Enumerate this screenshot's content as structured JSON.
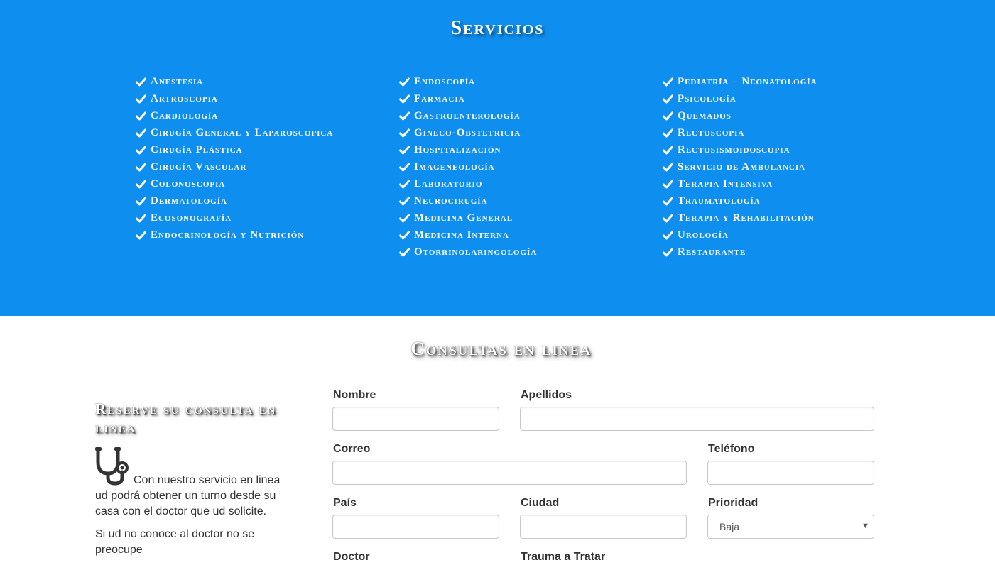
{
  "colors": {
    "services_bg": "#0e8ff0",
    "text": "#333333",
    "white": "#ffffff"
  },
  "services": {
    "title": "Servicios",
    "icon": "check-icon",
    "columns": [
      [
        "Anestesia",
        "Artroscopia",
        "Cardiología",
        "Cirugía General y Laparoscopica",
        "Cirugía Plástica",
        "Cirugía Vascular",
        "Colonoscopia",
        "Dermatología",
        "Ecosonografía",
        "Endocrinología y Nutrición"
      ],
      [
        "Endoscopía",
        "Farmacia",
        "Gastroenterología",
        "Gineco-Obstetricia",
        "Hospitalización",
        "Imageneología",
        "Laboratorio",
        "Neurocirugía",
        "Medicina General",
        "Medicina Interna",
        "Otorrinolaringología"
      ],
      [
        "Pediatría – Neonatología",
        "Psicología",
        "Quemados",
        "Rectoscopia",
        "Rectosismoidoscopia",
        "Servicio de Ambulancia",
        "Terapia Intensiva",
        "Traumatología",
        "Terapia y Rehabilitación",
        "Urología",
        "Restaurante"
      ]
    ]
  },
  "consultas": {
    "title": "Consultas en linea",
    "side_heading": "Reserve su consulta en linea",
    "side_icon": "stethoscope-icon",
    "side_text": "Con nuestro servicio en linea ud podrá obtener un turno desde su casa con el doctor que ud solicite.",
    "side_text2": "Si ud no conoce al doctor no se preocupe"
  },
  "form": {
    "nombre_label": "Nombre",
    "apellidos_label": "Apellidos",
    "correo_label": "Correo",
    "telefono_label": "Teléfono",
    "pais_label": "País",
    "ciudad_label": "Ciudad",
    "prioridad_label": "Prioridad",
    "prioridad_value": "Baja",
    "doctor_label": "Doctor",
    "trauma_label": "Trauma a Tratar"
  }
}
